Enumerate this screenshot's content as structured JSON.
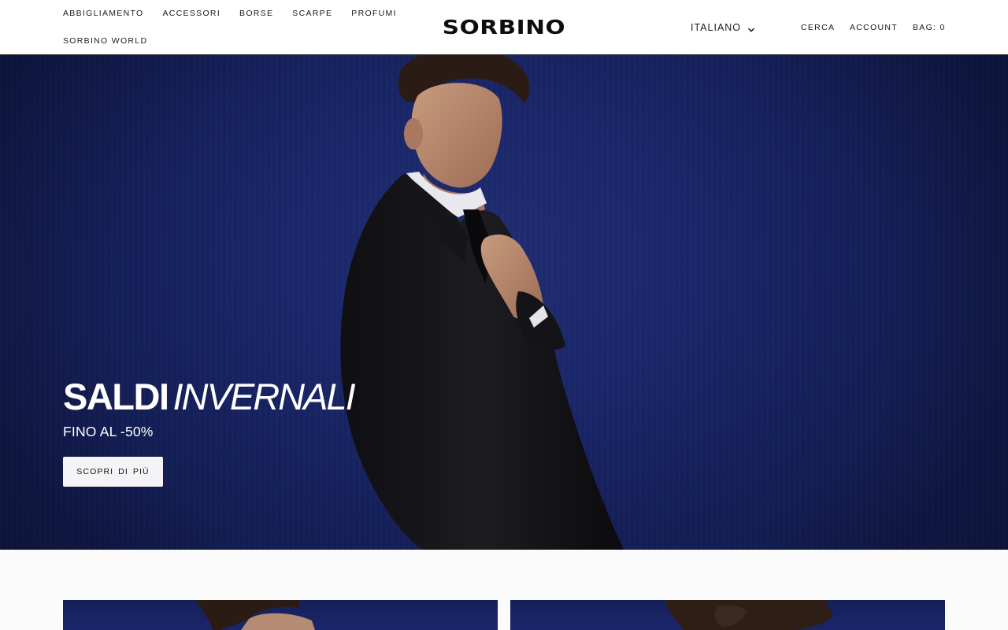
{
  "header": {
    "nav": [
      {
        "label": "ABBIGLIAMENTO"
      },
      {
        "label": "ACCESSORI"
      },
      {
        "label": "BORSE"
      },
      {
        "label": "SCARPE"
      },
      {
        "label": "PROFUMI"
      },
      {
        "label": "SORBINO WORLD"
      }
    ],
    "logo": "SORBINO",
    "language": {
      "selected": "ITALIANO",
      "icon": "chevron-down-icon"
    },
    "search_label": "CERCA",
    "account_label": "ACCOUNT",
    "bag_label": "BAG: 0"
  },
  "hero": {
    "title_regular": "SALDI",
    "title_accent": "INVERNALI",
    "subtitle": "FINO AL -50%",
    "cta_label": "SCOPRI DI PIÙ",
    "background_color": "#1a276a"
  },
  "colors": {
    "header_bg": "#ffffff",
    "text": "#1a1a1a",
    "hero_text": "#ffffff",
    "button_bg": "#f4f4f6"
  }
}
